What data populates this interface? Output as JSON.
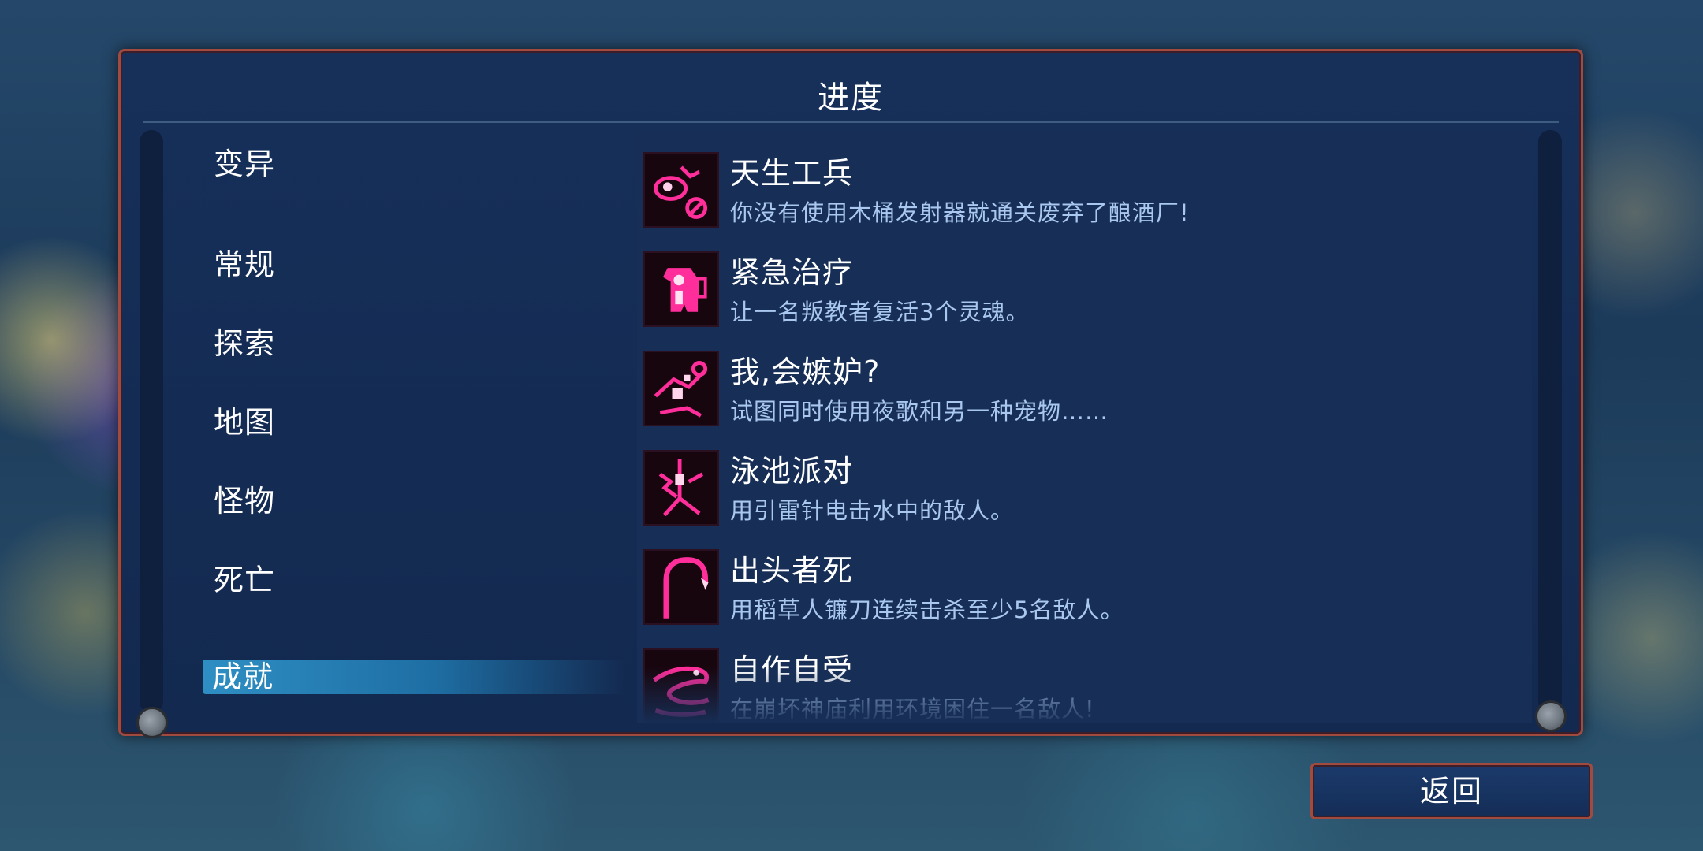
{
  "panel": {
    "title": "进度"
  },
  "categories": [
    {
      "label": "变异",
      "active": false
    },
    {
      "label": "常规",
      "active": false
    },
    {
      "label": "探索",
      "active": false
    },
    {
      "label": "地图",
      "active": false
    },
    {
      "label": "怪物",
      "active": false
    },
    {
      "label": "死亡",
      "active": false
    },
    {
      "label": "成就",
      "active": true
    }
  ],
  "achievements": [
    {
      "title": "天生工兵",
      "desc": "你没有使用木桶发射器就通关废弃了酿酒厂!",
      "icon": "barrel-launcher-crossed-icon"
    },
    {
      "title": "紧急治疗",
      "desc": "让一名叛教者复活3个灵魂。",
      "icon": "renegade-revive-icon"
    },
    {
      "title": "我,会嫉妒?",
      "desc": "试图同时使用夜歌和另一种宠物……",
      "icon": "jealous-pet-icon"
    },
    {
      "title": "泳池派对",
      "desc": "用引雷针电击水中的敌人。",
      "icon": "lightning-rod-icon"
    },
    {
      "title": "出头者死",
      "desc": "用稻草人镰刀连续击杀至少5名敌人。",
      "icon": "scythe-icon"
    },
    {
      "title": "自作自受",
      "desc": "在崩坏神庙利用环境困住一名敌人!",
      "icon": "trap-serpent-icon"
    }
  ],
  "footer": {
    "back_label": "返回"
  },
  "colors": {
    "accent_border": "#a14a40",
    "panel_bg": "#16305a",
    "badge_magenta": "#ff2e9a",
    "desc_text": "#a9c7ef",
    "active_tab": "#2e8fc4"
  }
}
